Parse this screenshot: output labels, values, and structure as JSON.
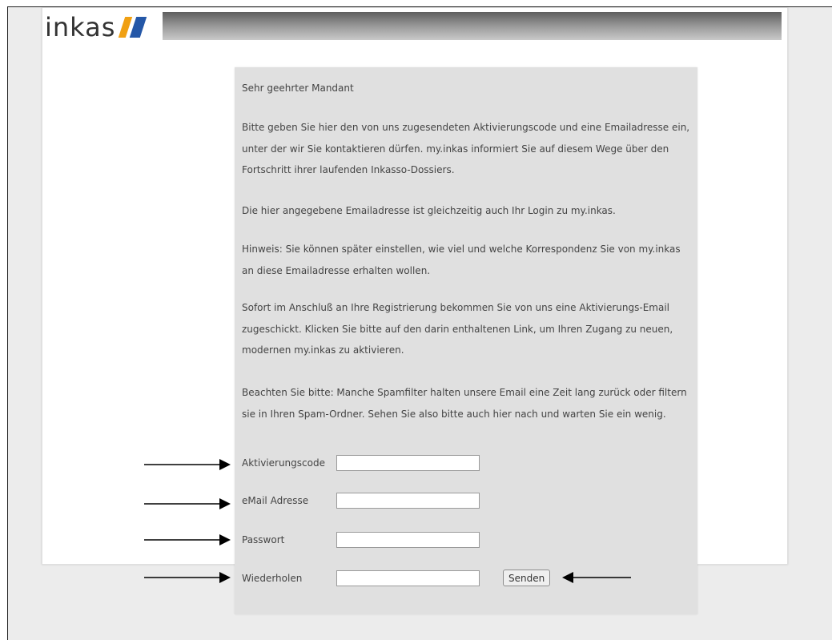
{
  "header": {
    "logo_text": "inkas"
  },
  "intro": {
    "greeting": "Sehr geehrter Mandant",
    "paragraph1": "Bitte geben Sie hier den von uns zugesendeten Aktivierungscode und eine Emailadresse ein, unter der wir Sie kontaktieren dürfen. my.inkas informiert Sie auf diesem Wege über den Fortschritt ihrer laufenden Inkasso-Dossiers.",
    "paragraph2": "Die hier angegebene Emailadresse ist gleichzeitig auch Ihr Login zu my.inkas.",
    "paragraph3": "Hinweis: Sie können später einstellen, wie viel und welche Korrespondenz Sie von my.inkas an diese Emailadresse erhalten wollen.",
    "paragraph4": "Sofort im Anschluß an Ihre Registrierung bekommen Sie von uns eine Aktivierungs-Email zugeschickt. Klicken Sie bitte auf den darin enthaltenen Link, um Ihren Zugang zu neuen, modernen my.inkas zu aktivieren.",
    "paragraph5": "Beachten Sie bitte: Manche Spamfilter halten unsere Email eine Zeit lang zurück oder filtern sie in Ihren Spam-Ordner. Sehen Sie also bitte auch hier nach und warten Sie ein wenig."
  },
  "form": {
    "activation_label": "Aktivierungscode",
    "activation_value": "",
    "email_label": "eMail Adresse",
    "email_value": "",
    "password_label": "Passwort",
    "password_value": "",
    "repeat_label": "Wiederholen",
    "repeat_value": "",
    "submit_label": "Senden"
  },
  "colors": {
    "logo_accent_orange": "#f0a013",
    "logo_accent_blue": "#2457a7",
    "form_background": "#e0e0e0"
  }
}
